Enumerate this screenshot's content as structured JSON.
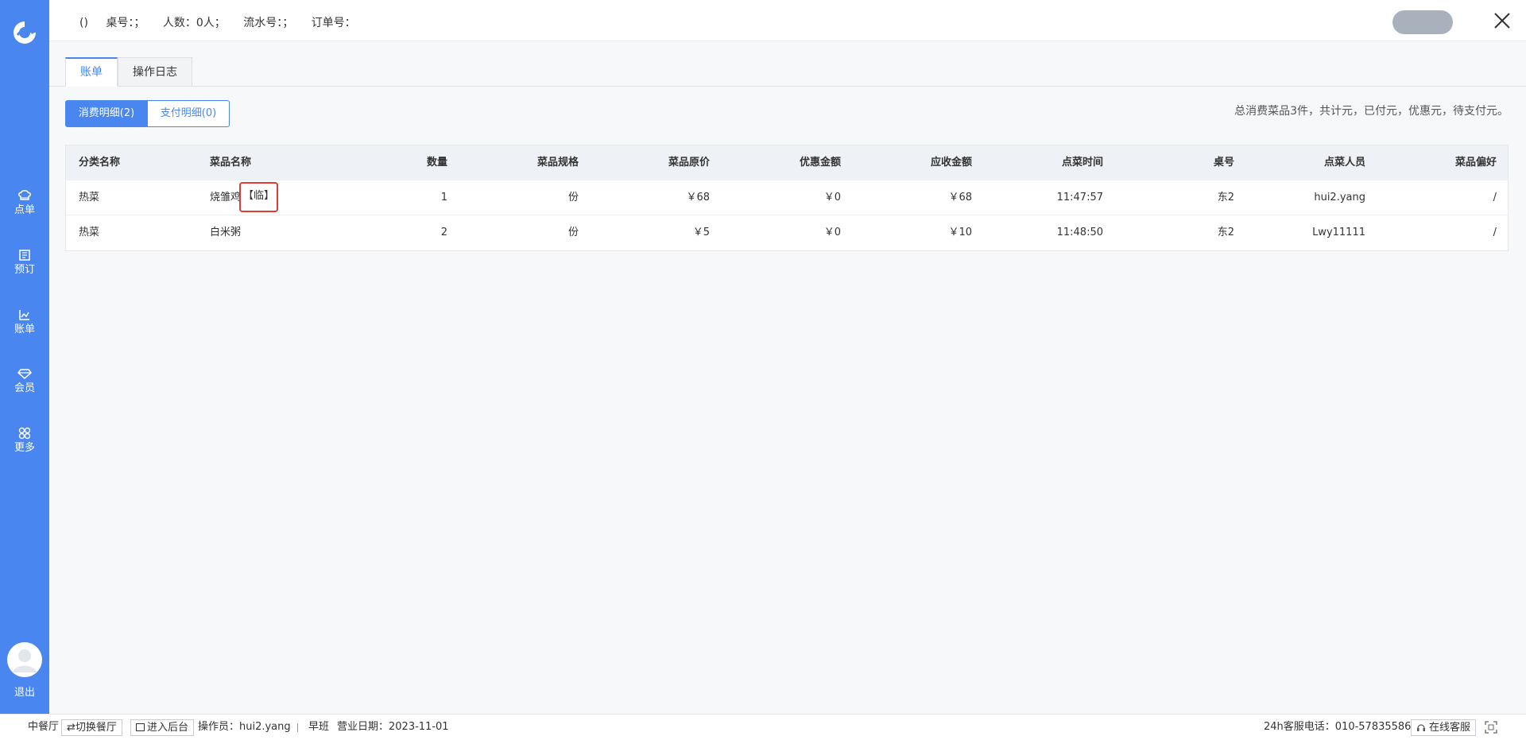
{
  "sidebar": {
    "items": [
      {
        "label": "点单",
        "icon": "chef-hat-icon"
      },
      {
        "label": "预订",
        "icon": "book-icon"
      },
      {
        "label": "账单",
        "icon": "chart-icon"
      },
      {
        "label": "会员",
        "icon": "diamond-icon"
      },
      {
        "label": "更多",
        "icon": "grid-icon"
      }
    ],
    "logout": "退出"
  },
  "header": {
    "paren": "()",
    "table_no": "桌号：；",
    "guests": "人数：0人；",
    "serial": "流水号：；",
    "order_no": "订单号："
  },
  "tabs": [
    {
      "label": "账单",
      "active": true
    },
    {
      "label": "操作日志",
      "active": false
    }
  ],
  "toggle": {
    "consume": "消费明细(2)",
    "payment": "支付明细(0)"
  },
  "summary": "总消费菜品3件，共计元，已付元，优惠元，待支付元。",
  "table": {
    "columns": [
      "分类名称",
      "菜品名称",
      "数量",
      "菜品规格",
      "菜品原价",
      "优惠金额",
      "应收金额",
      "点菜时间",
      "桌号",
      "点菜人员",
      "菜品偏好"
    ],
    "rows": [
      {
        "category": "热菜",
        "name": "烧雏鸡",
        "tag": "【临】",
        "qty": "1",
        "spec": "份",
        "price": "￥68",
        "discount": "￥0",
        "due": "￥68",
        "time": "11:47:57",
        "table": "东2",
        "staff": "hui2.yang",
        "pref": "/"
      },
      {
        "category": "热菜",
        "name": "白米粥",
        "tag": "",
        "qty": "2",
        "spec": "份",
        "price": "￥5",
        "discount": "￥0",
        "due": "￥10",
        "time": "11:48:50",
        "table": "东2",
        "staff": "Lwy11111",
        "pref": "/"
      }
    ]
  },
  "footer": {
    "hall": "中餐厅",
    "switch": "⇄切换餐厅",
    "backend": "进入后台",
    "operator": "操作员：hui2.yang",
    "shift": "早班",
    "biz_date": "营业日期：2023-11-01",
    "hotline": "24h客服电话：010-57835586",
    "online": "在线客服"
  },
  "colors": {
    "brand": "#4a86f0",
    "highlight": "#e53935"
  }
}
